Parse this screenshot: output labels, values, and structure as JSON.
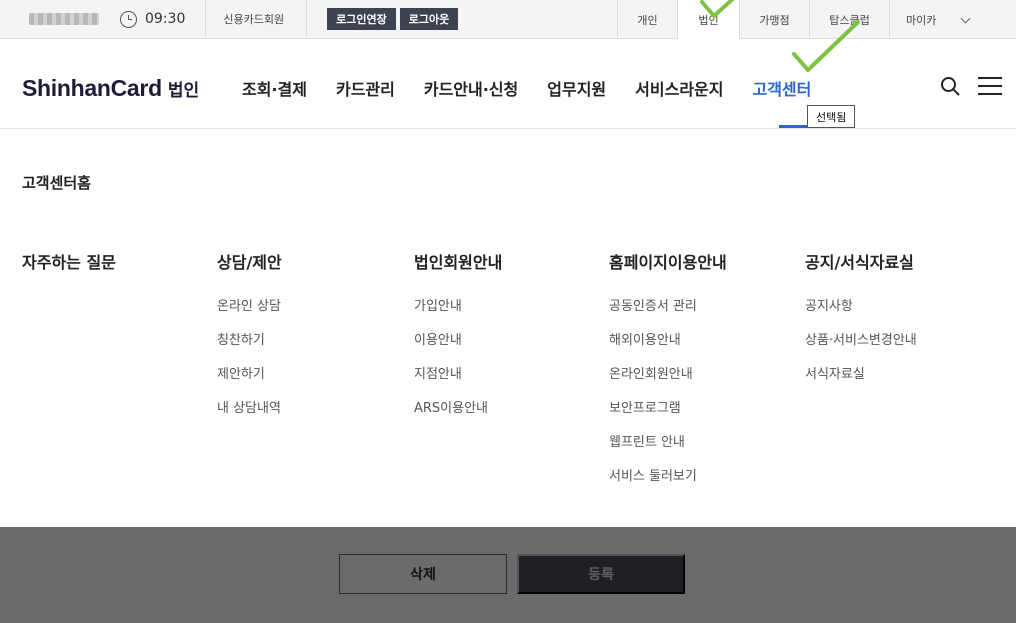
{
  "util_bar": {
    "time": "09:30",
    "membership": "신용카드회원",
    "extend_login": "로그인연장",
    "logout": "로그아웃",
    "tabs": [
      "개인",
      "법인",
      "가맹점",
      "탑스클럽"
    ],
    "my": "마이카"
  },
  "header": {
    "logo": "ShinhanCard",
    "logo_sub": "법인",
    "nav": [
      "조회·결제",
      "카드관리",
      "카드안내·신청",
      "업무지원",
      "서비스라운지",
      "고객센터"
    ],
    "tooltip": "선택됨"
  },
  "mega": {
    "home": "고객센터홈",
    "columns": [
      {
        "title": "자주하는 질문",
        "items": []
      },
      {
        "title": "상담/제안",
        "items": [
          "온라인 상담",
          "칭찬하기",
          "제안하기",
          "내 상담내역"
        ]
      },
      {
        "title": "법인회원안내",
        "items": [
          "가입안내",
          "이용안내",
          "지점안내",
          "ARS이용안내"
        ]
      },
      {
        "title": "홈페이지이용안내",
        "items": [
          "공동인증서 관리",
          "해외이용안내",
          "온라인회원안내",
          "보안프로그램",
          "웹프린트 안내",
          "서비스 둘러보기"
        ]
      },
      {
        "title": "공지/서식자료실",
        "items": [
          "공지사항",
          "상품·서비스변경안내",
          "서식자료실"
        ]
      }
    ]
  },
  "page": {
    "delete": "삭제",
    "register": "등록"
  },
  "colors": {
    "accent": "#2a67c9",
    "dark_button": "#3d4351",
    "check": "#7fc242"
  }
}
